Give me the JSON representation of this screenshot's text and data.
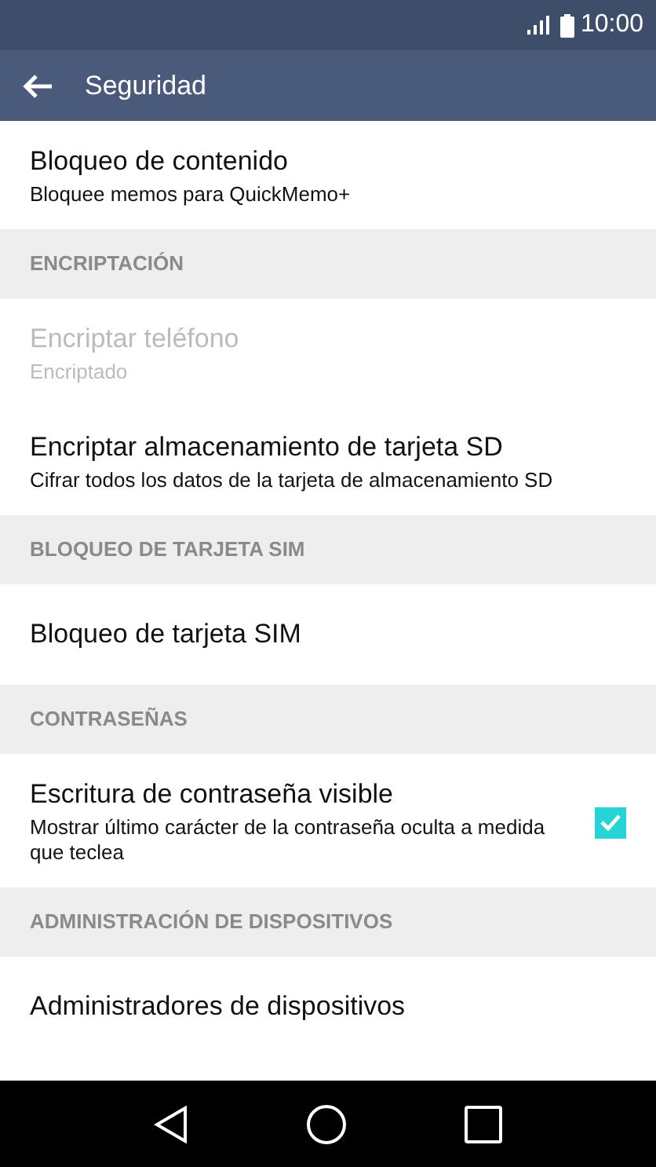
{
  "status_bar": {
    "time": "10:00"
  },
  "toolbar": {
    "title": "Seguridad"
  },
  "items": [
    {
      "kind": "setting",
      "title": "Bloqueo de contenido",
      "subtitle": "Bloquee memos para QuickMemo+",
      "disabled": false
    },
    {
      "kind": "header",
      "title": "ENCRIPTACIÓN"
    },
    {
      "kind": "setting",
      "title": "Encriptar teléfono",
      "subtitle": "Encriptado",
      "disabled": true
    },
    {
      "kind": "setting",
      "title": "Encriptar almacenamiento de tarjeta SD",
      "subtitle": "Cifrar todos los datos de la tarjeta de almacenamiento SD",
      "disabled": false
    },
    {
      "kind": "header",
      "title": "BLOQUEO DE TARJETA SIM"
    },
    {
      "kind": "setting",
      "title": "Bloqueo de tarjeta SIM",
      "disabled": false
    },
    {
      "kind": "header",
      "title": "CONTRASEÑAS"
    },
    {
      "kind": "setting",
      "title": "Escritura de contraseña visible",
      "subtitle": "Mostrar último carácter de la contraseña oculta a medida que teclea",
      "disabled": false,
      "checked": true
    },
    {
      "kind": "header",
      "title": "ADMINISTRACIÓN DE DISPOSITIVOS"
    },
    {
      "kind": "setting",
      "title": "Administradores de dispositivos",
      "disabled": false
    }
  ]
}
